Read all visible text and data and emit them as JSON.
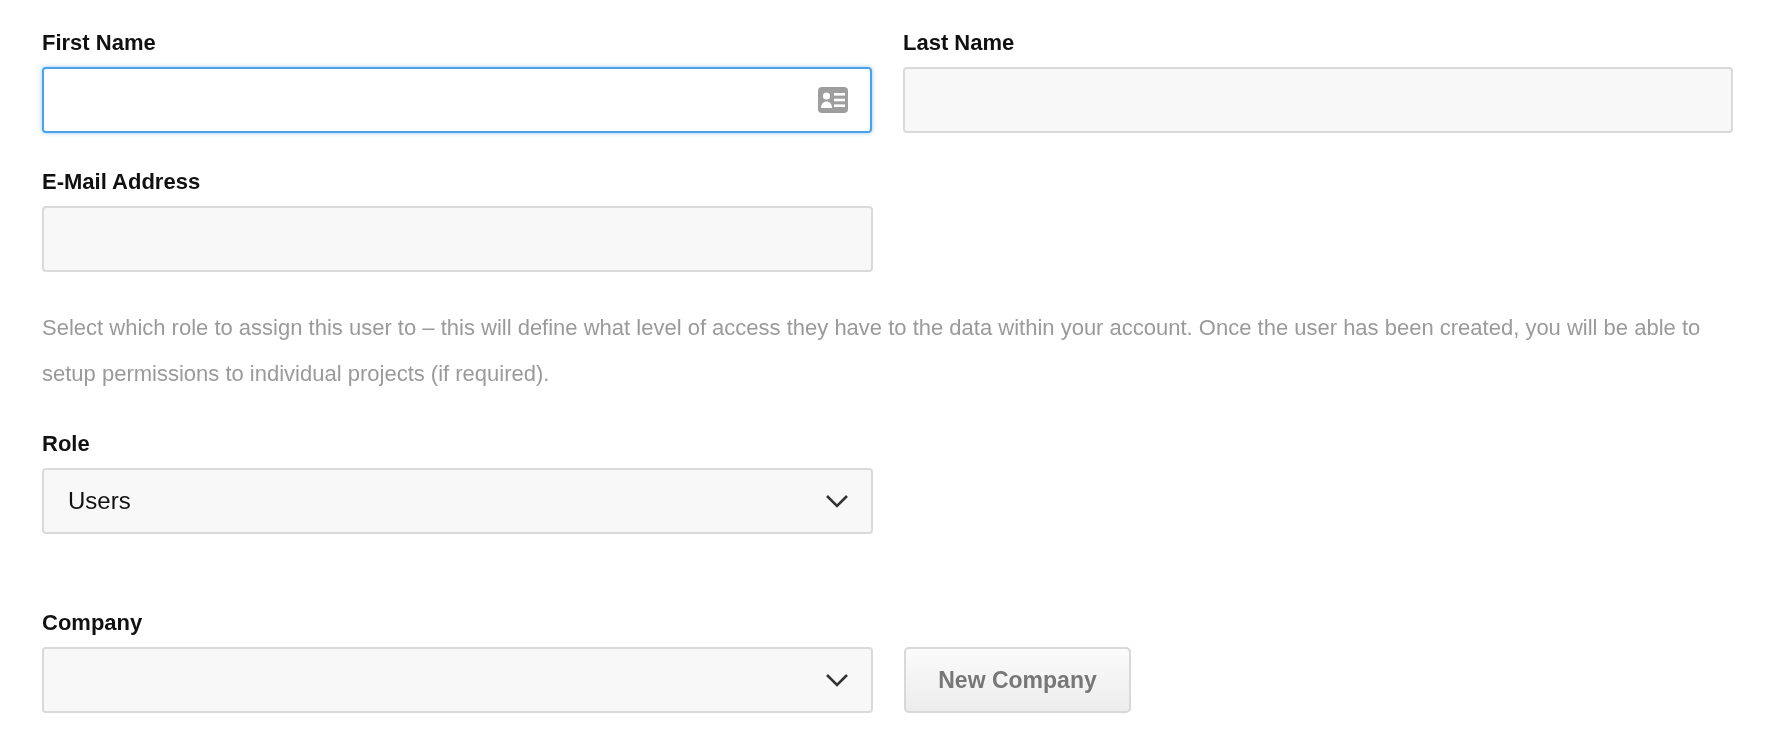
{
  "name_row": [
    {
      "kind": "text",
      "label": "First Name",
      "focused": true
    },
    {
      "kind": "text",
      "label": "Last Name",
      "focused": false
    }
  ],
  "email": {
    "kind": "text",
    "label": "E-Mail Address",
    "focused": false
  },
  "role_help": "Select which role to assign this user to – this will define what level of access they have to the data within your account. Once the user has been created, you will be able to setup permissions to individual projects (if required).",
  "role": {
    "kind": "select",
    "label": "Role",
    "value": "Users"
  },
  "company": {
    "kind": "select",
    "label": "Company"
  },
  "new_company_button": "New Company"
}
